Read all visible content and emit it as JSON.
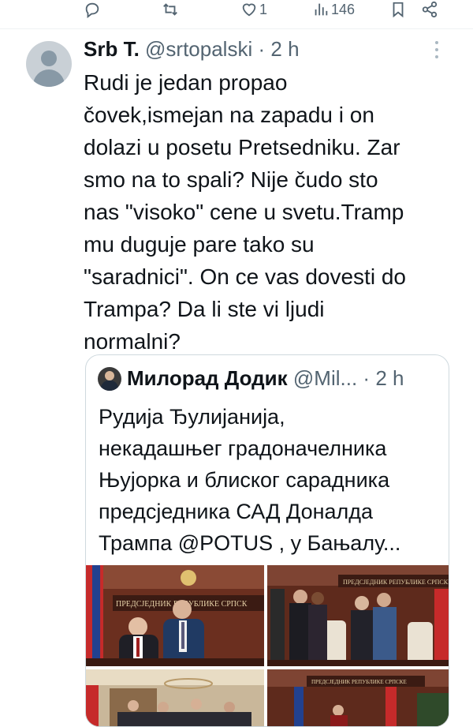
{
  "action_bar": {
    "reply_icon": "reply-icon",
    "retweet_icon": "retweet-icon",
    "like_icon": "heart-icon",
    "like_count": "1",
    "views_icon": "views-icon",
    "views_count": "146",
    "bookmark_icon": "bookmark-icon",
    "share_icon": "share-icon"
  },
  "tweet": {
    "author_name": "Srb T.",
    "handle": "@srtopalski",
    "separator": "·",
    "time": "2 h",
    "text_lines": [
      "Rudi je jedan propao",
      "čovek,ismejan na zapadu i on",
      "dolazi u posetu Pretsedniku. Zar",
      "smo na to spali? Nije čudo sto",
      "nas \"visoko\" cene u svetu.Tramp",
      "mu duguje pare tako su",
      "\"saradnici\". On ce vas dovesti do",
      "Trampa? Da li ste vi ljudi",
      "normalni?"
    ]
  },
  "quote": {
    "author_name": "Милорад Додик",
    "handle": "@Mil...",
    "separator": "·",
    "time": "2 h",
    "text_lines": [
      "Рудија Ђулијанија,",
      "некадашњег градоначелника",
      "Њујорка и блиског сарадника",
      "предсједника САД Доналда",
      "Трампа @POTUS , у Бањалу..."
    ],
    "photo1_sign": "ПРЕДСЈЕДНИК РЕПУБЛИКЕ СРПСК",
    "photo2_sign": "ПРЕДСЈЕДНИК РЕПУБЛИКЕ СРПСКЕ",
    "photo4_sign": "ПРЕДСЈЕДНИК РЕПУБЛИКЕ СРПСКЕ"
  },
  "colors": {
    "text": "#0f1419",
    "muted": "#536471",
    "border": "#cfd9de"
  }
}
